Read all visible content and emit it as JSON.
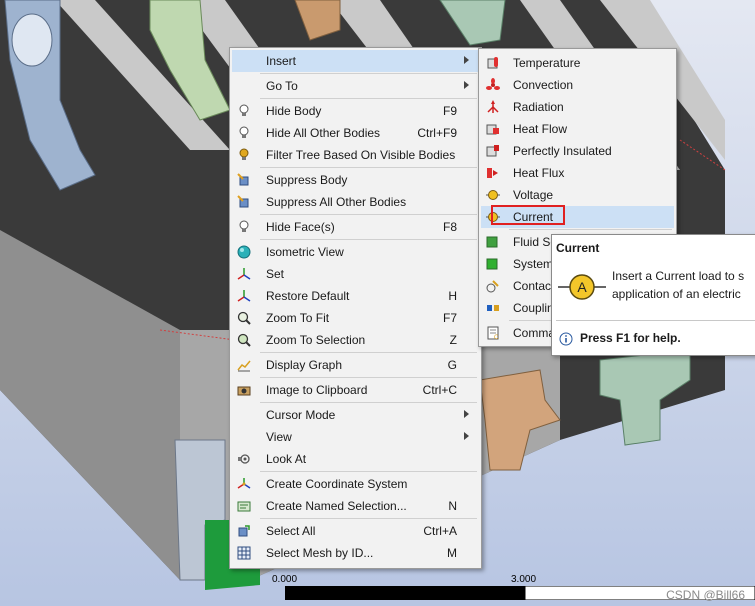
{
  "context_menu": {
    "items": [
      {
        "label": "Insert",
        "shortcut": "",
        "icon": "",
        "submenu": true
      },
      {
        "label": "Go To",
        "shortcut": "",
        "icon": "",
        "submenu": true
      },
      {
        "label": "Hide Body",
        "shortcut": "F9",
        "icon": "lightbulb-icon"
      },
      {
        "label": "Hide All Other Bodies",
        "shortcut": "Ctrl+F9",
        "icon": "lightbulb-icon"
      },
      {
        "label": "Filter Tree Based On Visible Bodies",
        "shortcut": "",
        "icon": "lightbulb-on-icon"
      },
      {
        "label": "Suppress Body",
        "shortcut": "",
        "icon": "suppress-body-icon"
      },
      {
        "label": "Suppress All Other Bodies",
        "shortcut": "",
        "icon": "suppress-others-icon"
      },
      {
        "label": "Hide Face(s)",
        "shortcut": "F8",
        "icon": "lightbulb-icon"
      },
      {
        "label": "Isometric View",
        "shortcut": "",
        "icon": "sphere-icon"
      },
      {
        "label": "Set",
        "shortcut": "",
        "icon": "axes-set-icon"
      },
      {
        "label": "Restore Default",
        "shortcut": "H",
        "icon": "axes-restore-icon"
      },
      {
        "label": "Zoom To Fit",
        "shortcut": "F7",
        "icon": "zoom-fit-icon"
      },
      {
        "label": "Zoom To Selection",
        "shortcut": "Z",
        "icon": "zoom-selection-icon"
      },
      {
        "label": "Display Graph",
        "shortcut": "G",
        "icon": "graph-icon"
      },
      {
        "label": "Image to Clipboard",
        "shortcut": "Ctrl+C",
        "icon": "camera-icon"
      },
      {
        "label": "Cursor Mode",
        "shortcut": "",
        "icon": "",
        "submenu": true
      },
      {
        "label": "View",
        "shortcut": "",
        "icon": "",
        "submenu": true
      },
      {
        "label": "Look At",
        "shortcut": "",
        "icon": "look-at-icon"
      },
      {
        "label": "Create Coordinate System",
        "shortcut": "",
        "icon": "coordinate-system-icon"
      },
      {
        "label": "Create Named Selection...",
        "shortcut": "N",
        "icon": "named-selection-icon"
      },
      {
        "label": "Select All",
        "shortcut": "Ctrl+A",
        "icon": "select-all-icon"
      },
      {
        "label": "Select Mesh by ID...",
        "shortcut": "M",
        "icon": "mesh-id-icon"
      }
    ]
  },
  "insert_submenu": {
    "items": [
      {
        "label": "Temperature",
        "icon": "temperature-icon"
      },
      {
        "label": "Convection",
        "icon": "convection-icon"
      },
      {
        "label": "Radiation",
        "icon": "radiation-icon"
      },
      {
        "label": "Heat Flow",
        "icon": "heat-flow-icon"
      },
      {
        "label": "Perfectly Insulated",
        "icon": "perfectly-insulated-icon"
      },
      {
        "label": "Heat Flux",
        "icon": "heat-flux-icon"
      },
      {
        "label": "Voltage",
        "icon": "voltage-icon"
      },
      {
        "label": "Current",
        "icon": "current-icon"
      },
      {
        "label": "Fluid Se",
        "icon": "fluid-solid-interface-icon"
      },
      {
        "label": "System",
        "icon": "system-coupling-icon"
      },
      {
        "label": "Contac",
        "icon": "contact-region-icon"
      },
      {
        "label": "Couplin",
        "icon": "coupling-icon"
      },
      {
        "label": "Comma",
        "icon": "commands-icon"
      }
    ]
  },
  "tooltip": {
    "title": "Current",
    "line1": "Insert a Current load to s",
    "line2": "application of an electric",
    "help": "Press F1 for help.",
    "icon_letter": "A"
  },
  "scale": {
    "start": "0.000",
    "mid": "3.000"
  },
  "watermark": "CSDN @Bill66",
  "colors": {
    "highlight": "#cce0f5",
    "selection_box": "#e02020",
    "menu_bg": "#f2f2f2"
  }
}
